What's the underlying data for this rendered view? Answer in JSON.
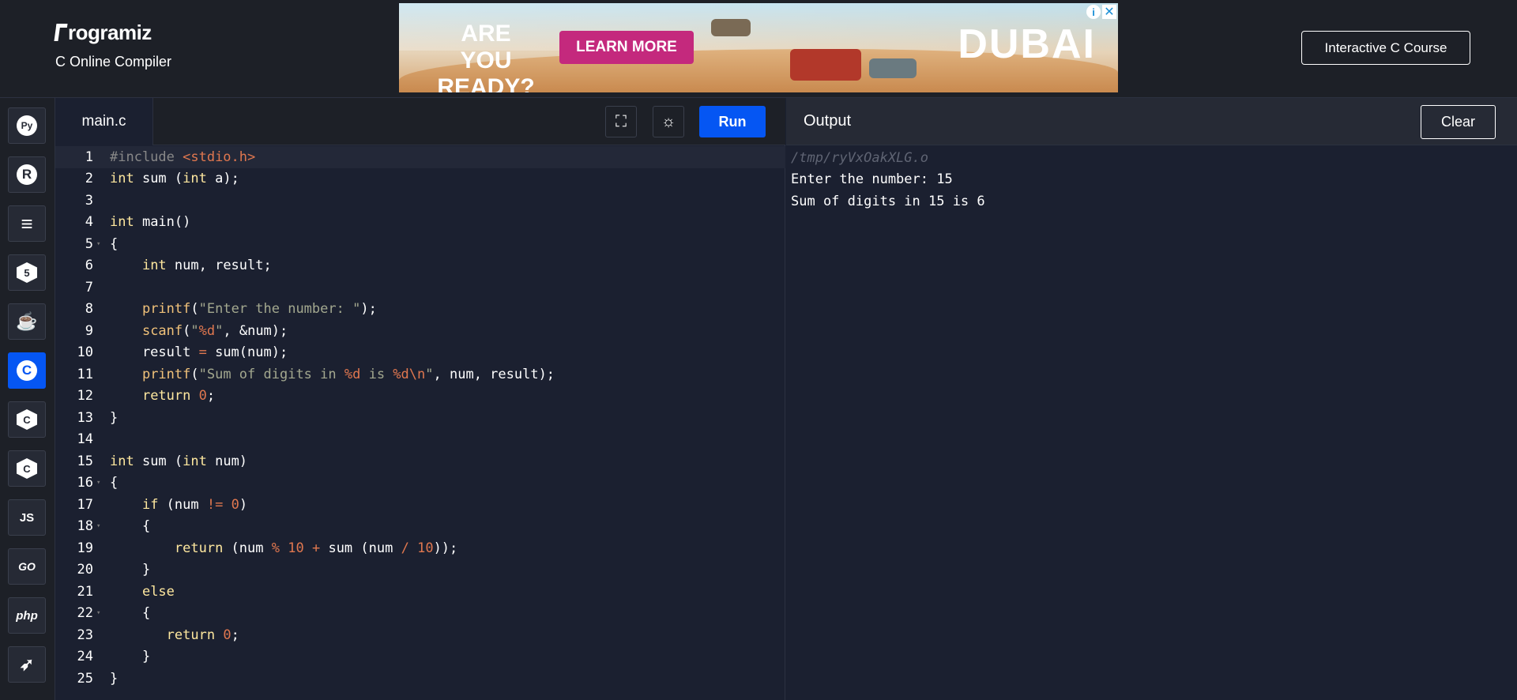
{
  "header": {
    "logo_text": "rogramiz",
    "subtitle": "C Online Compiler",
    "course_button": "Interactive C Course"
  },
  "ad": {
    "headline": "ARE YOU READY?",
    "cta": "LEARN MORE",
    "brand": "DUBAI",
    "info_icon": "i",
    "close_icon": "✕"
  },
  "sidebar": {
    "languages": [
      {
        "name": "python",
        "glyph": "Py"
      },
      {
        "name": "r",
        "glyph": "R"
      },
      {
        "name": "sql",
        "glyph": "≡"
      },
      {
        "name": "html",
        "glyph": "5"
      },
      {
        "name": "java",
        "glyph": "☕"
      },
      {
        "name": "c",
        "glyph": "C"
      },
      {
        "name": "cpp",
        "glyph": "C"
      },
      {
        "name": "csharp",
        "glyph": "C"
      },
      {
        "name": "javascript",
        "glyph": "JS"
      },
      {
        "name": "go",
        "glyph": "GO"
      },
      {
        "name": "php",
        "glyph": "php"
      },
      {
        "name": "swift",
        "glyph": "➶"
      }
    ],
    "active": "c"
  },
  "editor": {
    "tab_label": "main.c",
    "run_label": "Run",
    "fullscreen_icon": "⛶",
    "theme_icon": "☼"
  },
  "code_lines": [
    "#include <stdio.h>",
    "int sum (int a);",
    "",
    "int main()",
    "{",
    "    int num, result;",
    "",
    "    printf(\"Enter the number: \");",
    "    scanf(\"%d\", &num);",
    "    result = sum(num);",
    "    printf(\"Sum of digits in %d is %d\\n\", num, result);",
    "    return 0;",
    "}",
    "",
    "int sum (int num)",
    "{",
    "    if (num != 0)",
    "    {",
    "        return (num % 10 + sum (num / 10));",
    "    }",
    "    else",
    "    {",
    "       return 0;",
    "    }",
    "}"
  ],
  "output": {
    "title": "Output",
    "clear_label": "Clear",
    "lines": [
      "/tmp/ryVxOakXLG.o",
      "Enter the number: 15",
      "Sum of digits in 15 is 6"
    ]
  }
}
